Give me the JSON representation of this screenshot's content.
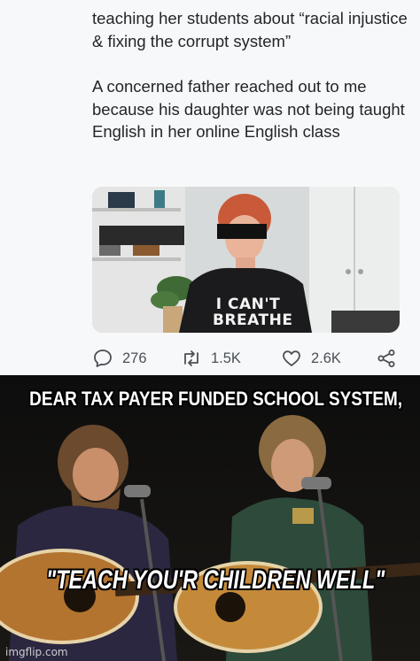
{
  "tweet": {
    "paragraph_1": "teaching her students about “racial injustice & fixing the corrupt system”",
    "paragraph_2": "A concerned father reached out to me because his daughter was not being taught English in her online English class",
    "media": {
      "shirt_line_1": "I CAN'T",
      "shirt_line_2": "BREATHE"
    },
    "actions": {
      "reply_count": "276",
      "retweet_count": "1.5K",
      "like_count": "2.6K",
      "icons": [
        "reply-icon",
        "retweet-icon",
        "heart-icon",
        "share-icon"
      ]
    }
  },
  "meme": {
    "top_caption": "DEAR TAX PAYER FUNDED SCHOOL SYSTEM,",
    "bottom_caption": "\"TEACH YOU'R CHILDREN WELL\"",
    "watermark": "imgflip.com"
  }
}
